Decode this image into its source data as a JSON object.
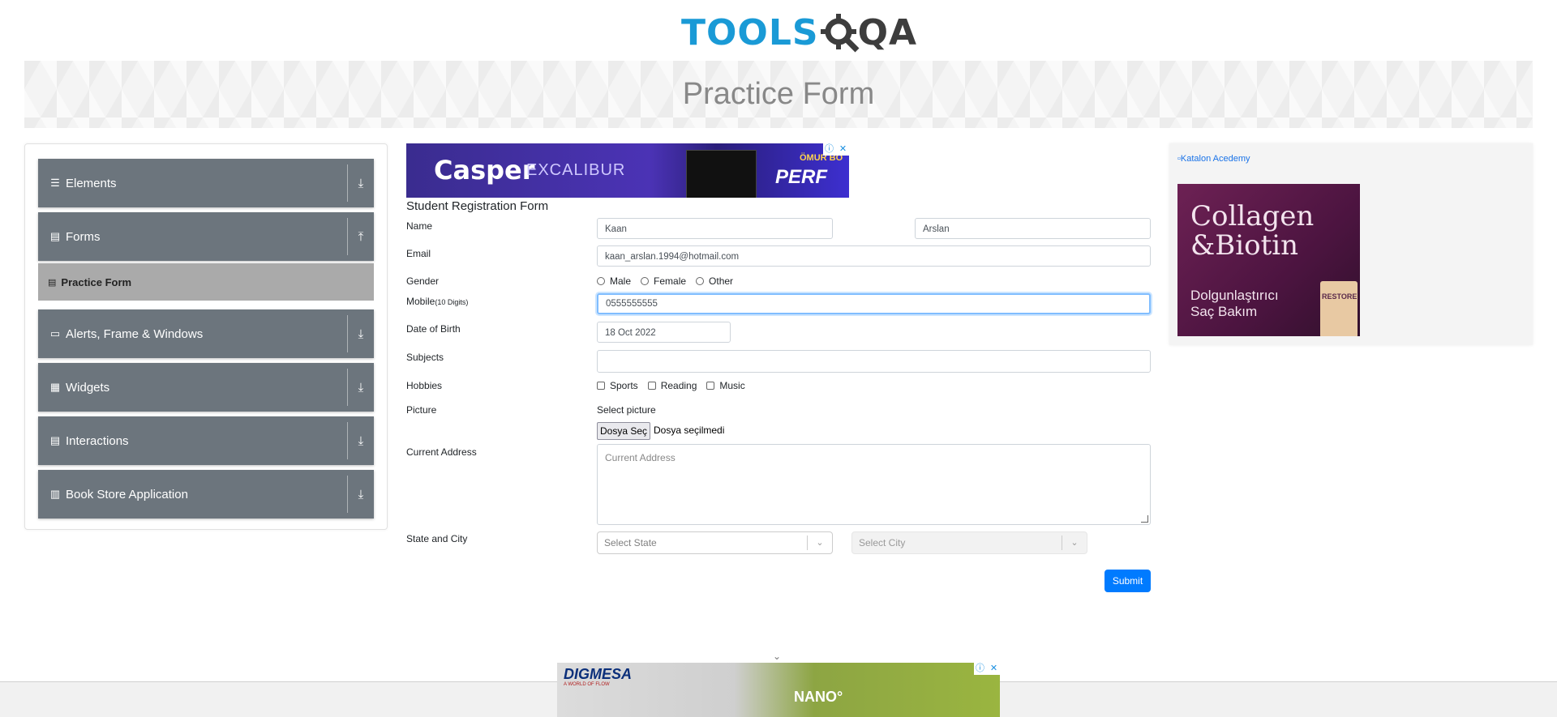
{
  "header": {
    "logo_part1": "TOOLS",
    "logo_part2": "QA",
    "banner_title": "Practice Form"
  },
  "sidebar": {
    "groups": [
      {
        "label": "Elements",
        "icon": "hamburger-icon",
        "arrow": "down-arrow-icon"
      },
      {
        "label": "Forms",
        "icon": "document-icon",
        "arrow": "up-arrow-icon"
      },
      {
        "label": "Alerts, Frame & Windows",
        "icon": "window-icon",
        "arrow": "down-arrow-icon"
      },
      {
        "label": "Widgets",
        "icon": "grid-icon",
        "arrow": "down-arrow-icon"
      },
      {
        "label": "Interactions",
        "icon": "list-icon",
        "arrow": "down-arrow-icon"
      },
      {
        "label": "Book Store Application",
        "icon": "books-icon",
        "arrow": "down-arrow-icon"
      }
    ],
    "active_subitem": "Practice Form"
  },
  "ad_top": {
    "brand": "Casper",
    "subbrand": "EXCALIBUR",
    "tagline": "ÖMUR BO",
    "perf": "PERF"
  },
  "form": {
    "title": "Student Registration Form",
    "labels": {
      "name": "Name",
      "email": "Email",
      "gender": "Gender",
      "mobile": "Mobile",
      "mobile_hint": "(10 Digits)",
      "dob": "Date of Birth",
      "subjects": "Subjects",
      "hobbies": "Hobbies",
      "picture": "Picture",
      "address": "Current Address",
      "state_city": "State and City"
    },
    "first_name": "Kaan",
    "last_name": "Arslan",
    "email": "kaan_arslan.1994@hotmail.com",
    "gender_options": [
      "Male",
      "Female",
      "Other"
    ],
    "mobile": "0555555555",
    "dob": "18 Oct 2022",
    "subjects": "",
    "hobbies": [
      "Sports",
      "Reading",
      "Music"
    ],
    "picture_label": "Select picture",
    "file_button": "Dosya Seç",
    "file_status": "Dosya seçilmedi",
    "address_placeholder": "Current Address",
    "state_placeholder": "Select State",
    "city_placeholder": "Select City",
    "submit": "Submit"
  },
  "right_ad": {
    "alt_text": "Katalon Acedemy",
    "headline_1": "Collagen",
    "headline_2": "&Biotin",
    "sub_1": "Dolgunlaştırıcı",
    "sub_2": "Saç Bakım",
    "product": "RESTORE"
  },
  "ad_bottom": {
    "brand": "DIGMESA",
    "tagline": "A WORLD OF FLOW",
    "product": "NANO°"
  },
  "colors": {
    "sidebar_group": "#6c757d",
    "active_subitem": "#aaaaaa",
    "submit": "#007bff",
    "logo_blue": "#1a9ad6"
  }
}
